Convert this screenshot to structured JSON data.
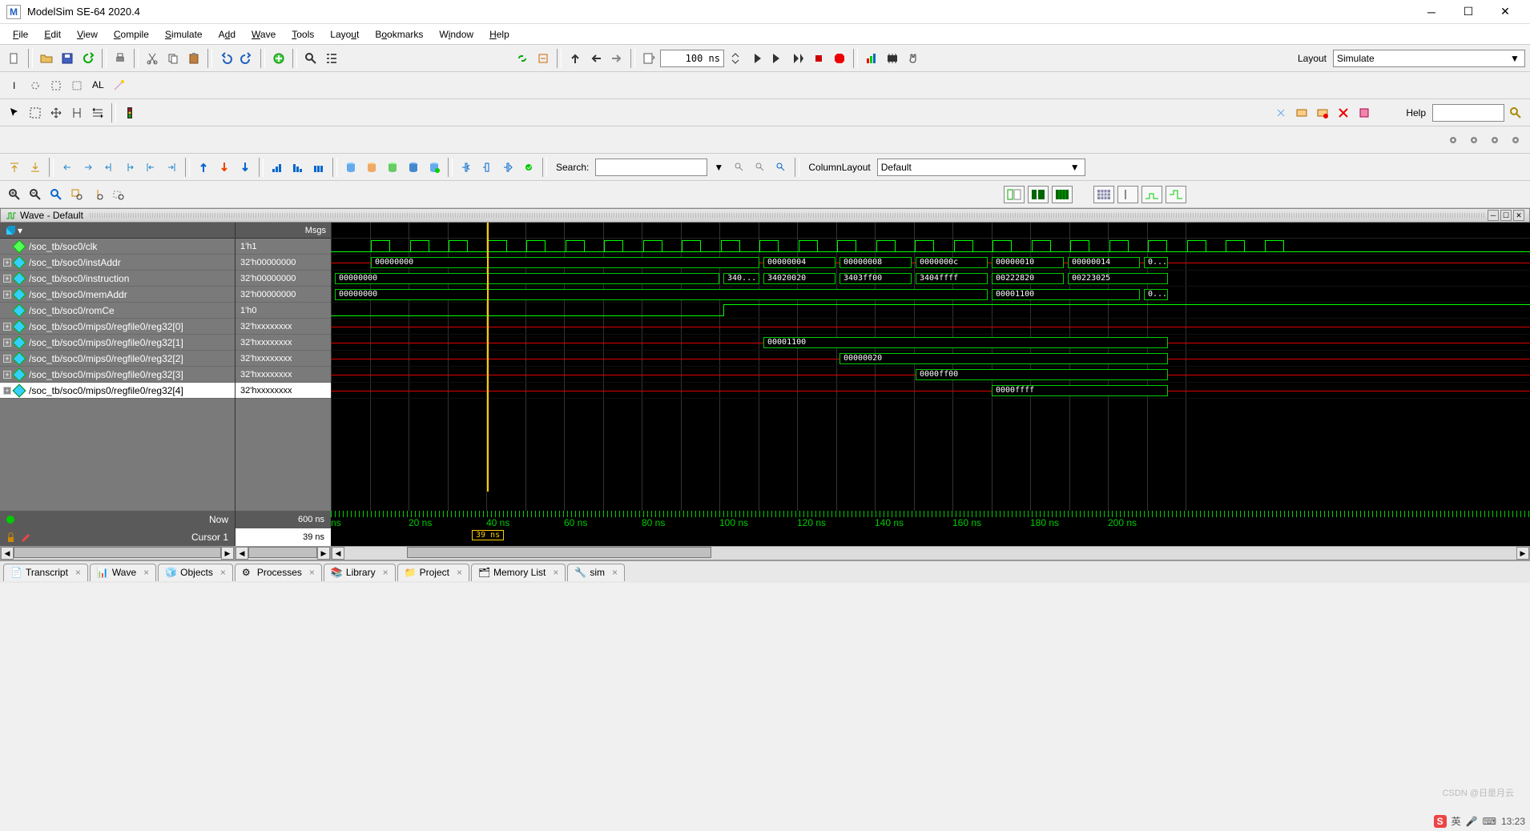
{
  "app": {
    "title": "ModelSim SE-64 2020.4",
    "logo": "M"
  },
  "menu": [
    "File",
    "Edit",
    "View",
    "Compile",
    "Simulate",
    "Add",
    "Wave",
    "Tools",
    "Layout",
    "Bookmarks",
    "Window",
    "Help"
  ],
  "toolbar1": {
    "time_value": "100 ns",
    "layout_label": "Layout",
    "layout_value": "Simulate"
  },
  "toolbar3": {
    "help_label": "Help"
  },
  "toolbar5": {
    "search_label": "Search:",
    "search_value": "",
    "column_layout_label": "ColumnLayout",
    "column_layout_value": "Default"
  },
  "wave_panel": {
    "title": "Wave - Default",
    "name_header": "",
    "msgs_header": "Msgs",
    "signals": [
      {
        "name": "/soc_tb/soc0/clk",
        "msg": "1'h1",
        "exp": false,
        "sel": false,
        "kind": "clk"
      },
      {
        "name": "/soc_tb/soc0/instAddr",
        "msg": "32'h00000000",
        "exp": true,
        "sel": false,
        "kind": "bus"
      },
      {
        "name": "/soc_tb/soc0/instruction",
        "msg": "32'h00000000",
        "exp": true,
        "sel": false,
        "kind": "bus"
      },
      {
        "name": "/soc_tb/soc0/memAddr",
        "msg": "32'h00000000",
        "exp": true,
        "sel": false,
        "kind": "bus"
      },
      {
        "name": "/soc_tb/soc0/romCe",
        "msg": "1'h0",
        "exp": false,
        "sel": false,
        "kind": "wire"
      },
      {
        "name": "/soc_tb/soc0/mips0/regfile0/reg32[0]",
        "msg": "32'hxxxxxxxx",
        "exp": true,
        "sel": false,
        "kind": "busx"
      },
      {
        "name": "/soc_tb/soc0/mips0/regfile0/reg32[1]",
        "msg": "32'hxxxxxxxx",
        "exp": true,
        "sel": false,
        "kind": "busx"
      },
      {
        "name": "/soc_tb/soc0/mips0/regfile0/reg32[2]",
        "msg": "32'hxxxxxxxx",
        "exp": true,
        "sel": false,
        "kind": "busx"
      },
      {
        "name": "/soc_tb/soc0/mips0/regfile0/reg32[3]",
        "msg": "32'hxxxxxxxx",
        "exp": true,
        "sel": false,
        "kind": "busx"
      },
      {
        "name": "/soc_tb/soc0/mips0/regfile0/reg32[4]",
        "msg": "32'hxxxxxxxx",
        "exp": true,
        "sel": true,
        "kind": "busx"
      }
    ],
    "now_label": "Now",
    "now_value": "600 ns",
    "cursor_label": "Cursor 1",
    "cursor_value": "39 ns",
    "cursor_tag": "39 ns",
    "time_ticks": [
      "ns",
      "20 ns",
      "40 ns",
      "60 ns",
      "80 ns",
      "100 ns",
      "120 ns",
      "140 ns",
      "160 ns",
      "180 ns",
      "200 ns"
    ],
    "bus_instAddr": [
      "00000000",
      "00000004",
      "00000008",
      "0000000c",
      "00000010",
      "00000014",
      "0..."
    ],
    "bus_instruction": [
      "00000000",
      "340...",
      "34020020",
      "3403ff00",
      "3404ffff",
      "00222820",
      "00223025"
    ],
    "bus_memAddr": [
      "00000000",
      "00001100",
      "0..."
    ],
    "bus_reg1": "00001100",
    "bus_reg2": "00000020",
    "bus_reg3": "0000ff00",
    "bus_reg4": "0000ffff"
  },
  "tabs": [
    "Transcript",
    "Wave",
    "Objects",
    "Processes",
    "Library",
    "Project",
    "Memory List",
    "sim"
  ],
  "watermark": "CSDN @日是月云",
  "tray": {
    "ime": "英",
    "time": "13:23"
  }
}
